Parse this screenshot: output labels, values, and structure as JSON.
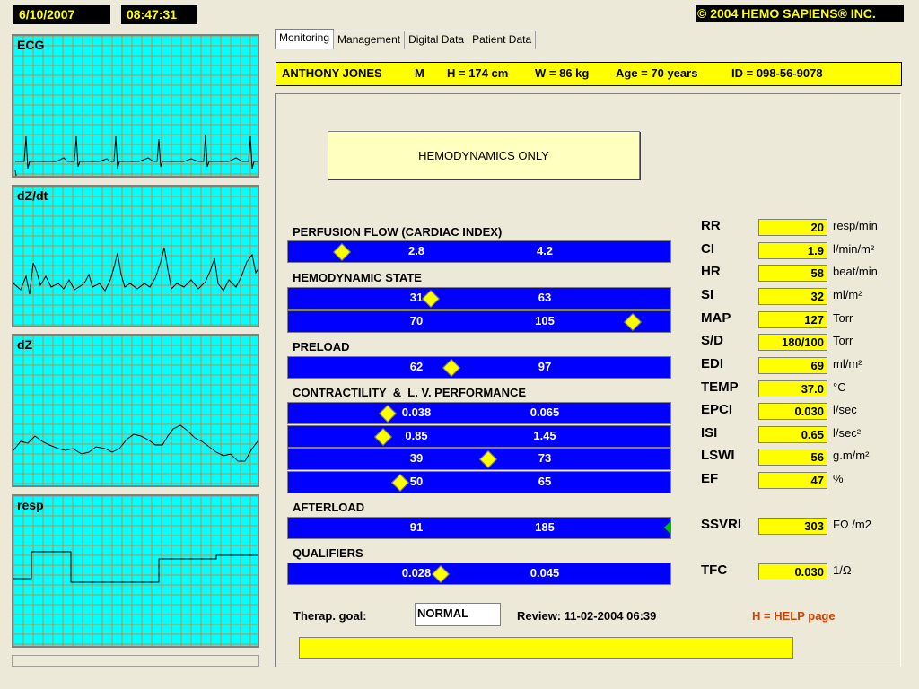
{
  "header": {
    "date": "6/10/2007",
    "time": "08:47:31",
    "copyright": "© 2004 HEMO SAPIENS® INC."
  },
  "graphs": [
    {
      "label": "ECG"
    },
    {
      "label": "dZ/dt"
    },
    {
      "label": "dZ"
    },
    {
      "label": "resp"
    }
  ],
  "tabs": [
    "Monitoring",
    "Management",
    "Digital Data",
    "Patient Data"
  ],
  "patient": {
    "name": "ANTHONY JONES",
    "sex": "M",
    "height": "H = 174 cm",
    "weight": "W = 86 kg",
    "age": "Age = 70 years",
    "id": "ID = 098-56-9078"
  },
  "mode_label": "HEMODYNAMICS ONLY",
  "sections": {
    "perfusion": "PERFUSION FLOW (CARDIAC INDEX)",
    "hemodynamic": "HEMODYNAMIC STATE",
    "preload": "PRELOAD",
    "contractility": "CONTRACTILITY  &  L. V. PERFORMANCE",
    "afterload": "AFTERLOAD",
    "qualifiers": "QUALIFIERS"
  },
  "bars": [
    {
      "low": "2.8",
      "high": "4.2"
    },
    {
      "low": "31",
      "high": "63"
    },
    {
      "low": "70",
      "high": "105"
    },
    {
      "low": "62",
      "high": "97"
    },
    {
      "low": "0.038",
      "high": "0.065"
    },
    {
      "low": "0.85",
      "high": "1.45"
    },
    {
      "low": "39",
      "high": "73"
    },
    {
      "low": "50",
      "high": "65"
    },
    {
      "low": "91",
      "high": "185"
    },
    {
      "low": "0.028",
      "high": "0.045"
    }
  ],
  "params": [
    {
      "label": "RR",
      "value": "20",
      "unit": "resp/min"
    },
    {
      "label": "CI",
      "value": "1.9",
      "unit": "l/min/m²"
    },
    {
      "label": "HR",
      "value": "58",
      "unit": "beat/min"
    },
    {
      "label": "SI",
      "value": "32",
      "unit": "ml/m²"
    },
    {
      "label": "MAP",
      "value": "127",
      "unit": "Torr"
    },
    {
      "label": "S/D",
      "value": "180/100",
      "unit": "Torr"
    },
    {
      "label": "EDI",
      "value": "69",
      "unit": "ml/m²"
    },
    {
      "label": "TEMP",
      "value": "37.0",
      "unit": "°C"
    },
    {
      "label": "EPCI",
      "value": "0.030",
      "unit": "l/sec"
    },
    {
      "label": "ISI",
      "value": "0.65",
      "unit": "l/sec²"
    },
    {
      "label": "LSWI",
      "value": "56",
      "unit": "g.m/m²"
    },
    {
      "label": "EF",
      "value": "47",
      "unit": "%"
    },
    {
      "label": "SSVRI",
      "value": "303",
      "unit": "FΩ /m2"
    },
    {
      "label": "TFC",
      "value": "0.030",
      "unit": "1/Ω"
    }
  ],
  "footer": {
    "therap_label": "Therap. goal:",
    "therap_value": "NORMAL",
    "review": "Review: 11-02-2004 06:39",
    "help": "H = HELP page"
  },
  "colors": {
    "bar": "#0000ff",
    "marker": "#ffff00",
    "graph_bg": "#00ffff",
    "grid": "#cc8844"
  }
}
